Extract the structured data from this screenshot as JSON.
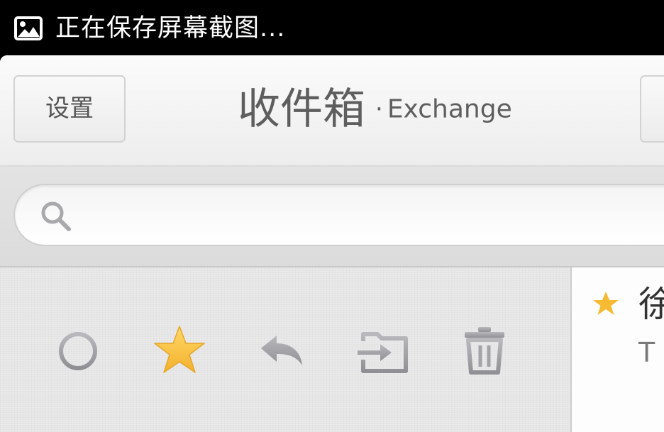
{
  "status_bar": {
    "icon": "image-icon",
    "message": "正在保存屏幕截图..."
  },
  "header": {
    "settings_label": "设置",
    "title": "收件箱",
    "separator": "·",
    "account": "Exchange"
  },
  "search": {
    "icon": "search-icon",
    "placeholder": "",
    "value": ""
  },
  "actions": [
    {
      "name": "mark-unread",
      "icon": "circle-icon"
    },
    {
      "name": "star",
      "icon": "star-icon",
      "color": "#f6bb33"
    },
    {
      "name": "reply",
      "icon": "reply-icon"
    },
    {
      "name": "move",
      "icon": "move-to-folder-icon"
    },
    {
      "name": "delete",
      "icon": "trash-icon"
    }
  ],
  "message_list": [
    {
      "starred": true,
      "sender": "徐",
      "preview": "T"
    }
  ],
  "colors": {
    "star": "#f6bb33",
    "icon_gray": "#a9a9ad",
    "title_text": "#5e5e5e"
  }
}
